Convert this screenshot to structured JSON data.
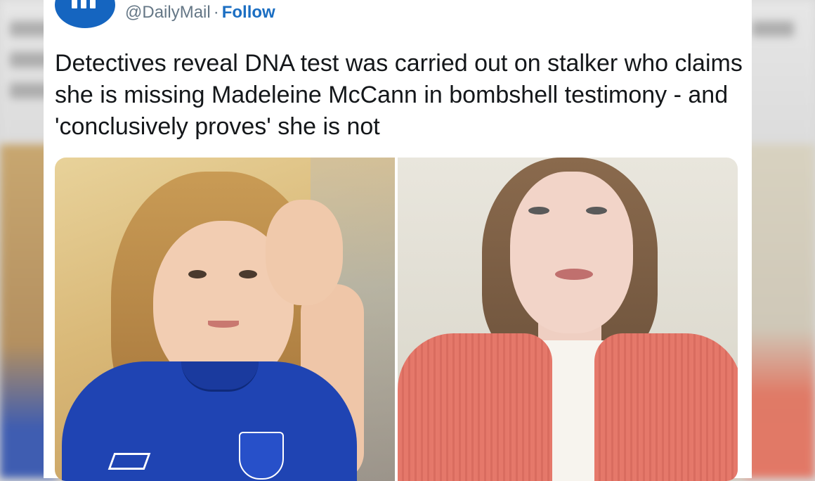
{
  "tweet": {
    "handle": "@DailyMail",
    "separator": "·",
    "follow_label": "Follow",
    "text": "Detectives reveal DNA test was carried out on stalker who claims she is missing Madeleine McCann in bombshell testimony - and 'conclusively proves' she is not",
    "media": [
      {
        "subject": "photo of young girl in blue football shirt"
      },
      {
        "subject": "photo of young woman in coral cardigan"
      }
    ]
  },
  "colors": {
    "link": "#1b6ec2",
    "handle": "#657786",
    "avatar": "#1565c0",
    "text": "#14171a"
  },
  "icons": {
    "avatar": "daily-mail-logo-avatar"
  }
}
